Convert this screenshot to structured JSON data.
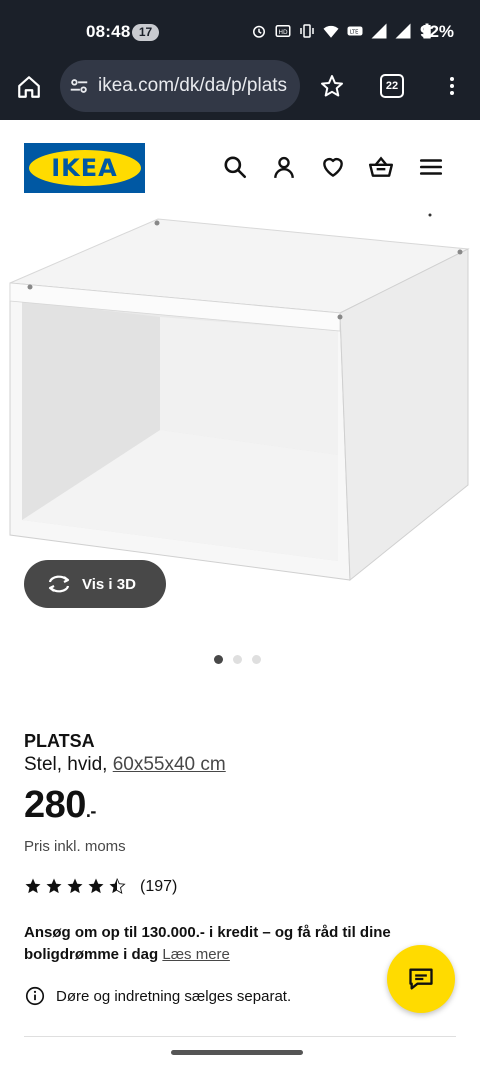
{
  "status_bar": {
    "time": "08:48",
    "notification_count": "17",
    "battery": "92%",
    "icons": [
      "alarm-icon",
      "hd-icon",
      "vibrate-icon",
      "wifi-icon",
      "volte-icon",
      "signal-icon",
      "signal-icon",
      "battery-icon"
    ]
  },
  "browser": {
    "url": "ikea.com/dk/da/p/plats",
    "tab_count": "22",
    "icons": [
      "home-icon",
      "site-settings-icon",
      "star-icon",
      "tabs-icon",
      "more-vert-icon"
    ]
  },
  "header": {
    "logo_text": "IKEA",
    "icons": [
      "search-icon",
      "profile-icon",
      "heart-icon",
      "basket-icon",
      "menu-icon"
    ]
  },
  "gallery": {
    "view_3d_label": "Vis i 3D",
    "active_dot": 0,
    "dot_count": 3
  },
  "product": {
    "name": "PLATSA",
    "desc_prefix": "Stel, hvid,",
    "dimensions": "60x55x40 cm",
    "price_main": "280",
    "price_suffix": ".-",
    "vat_note": "Pris inkl. moms",
    "rating": 4.5,
    "rating_count": "(197)",
    "credit_text": "Ansøg om op til 130.000.- i kredit – og få råd til dine boligdrømme i dag",
    "credit_link": "Læs mere",
    "info_text": "Døre og indretning sælges separat."
  },
  "colors": {
    "ikea_blue": "#0058a3",
    "ikea_yellow": "#ffdb00",
    "status_bg": "#1b2029"
  }
}
